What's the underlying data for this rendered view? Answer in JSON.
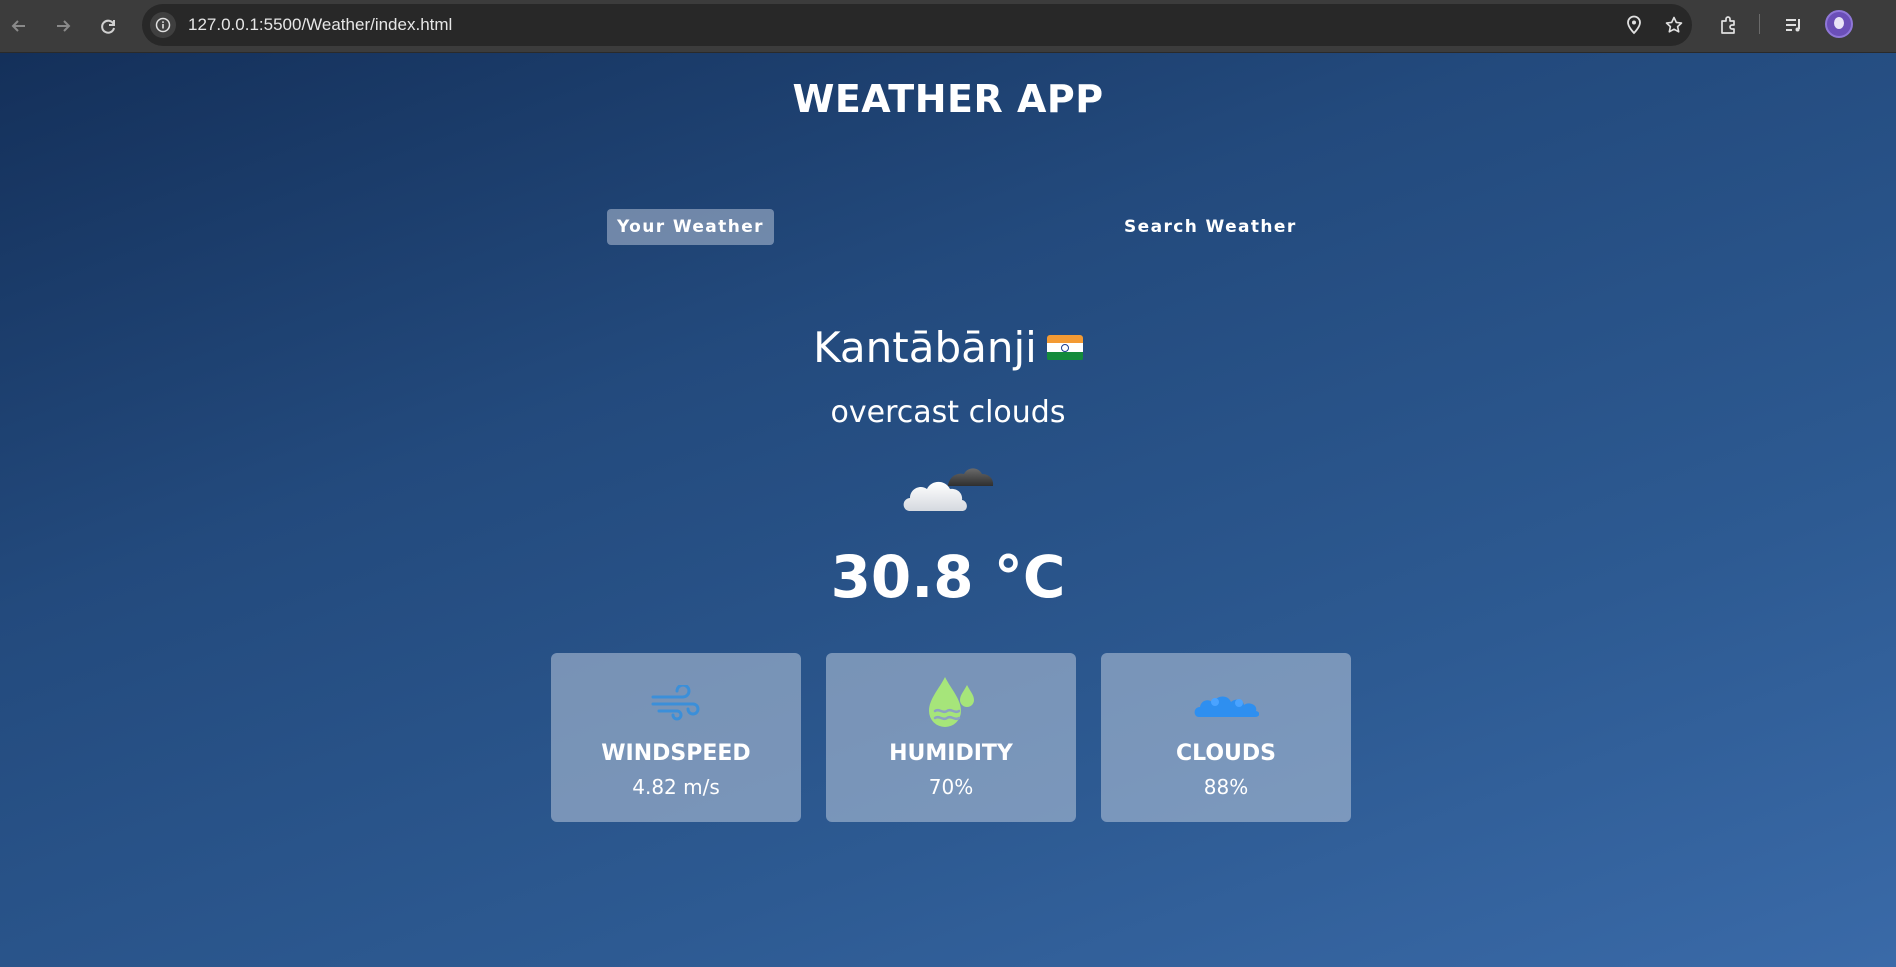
{
  "browser": {
    "url": "127.0.0.1:5500/Weather/index.html"
  },
  "app": {
    "title": "WEATHER APP",
    "tabs": [
      {
        "label": "Your Weather",
        "active": true
      },
      {
        "label": "Search Weather",
        "active": false
      }
    ]
  },
  "weather": {
    "city": "Kantābānji",
    "description": "overcast clouds",
    "icon": "cloud-icon",
    "temperature": "30.8 °C",
    "cards": [
      {
        "label": "WINDSPEED",
        "value": "4.82 m/s",
        "icon": "wind-icon",
        "icon_color": "#3b8fd9"
      },
      {
        "label": "HUMIDITY",
        "value": "70%",
        "icon": "humidity-icon",
        "icon_color": "#a6e57a"
      },
      {
        "label": "CLOUDS",
        "value": "88%",
        "icon": "clouds-icon",
        "icon_color": "#2e8ff0"
      }
    ]
  },
  "colors": {
    "background_top": "#14305a",
    "background_bottom": "#3a6aa8",
    "active_tab": "#9aabc4",
    "card": "#8da3c2"
  }
}
